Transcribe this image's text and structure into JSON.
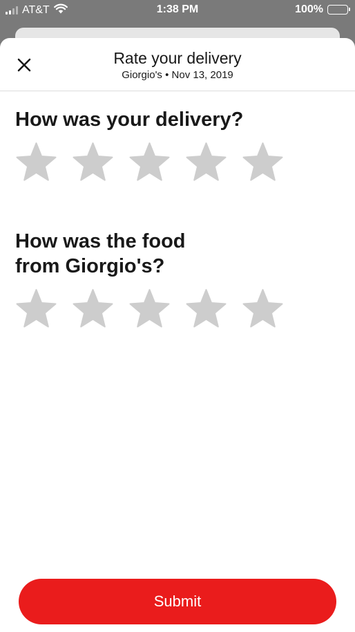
{
  "status_bar": {
    "carrier": "AT&T",
    "time": "1:38 PM",
    "battery": "100%",
    "icons": [
      "signal-icon",
      "wifi-icon",
      "battery-icon"
    ]
  },
  "header": {
    "title": "Rate your delivery",
    "subtitle": "Giorgio's • Nov 13, 2019",
    "close_icon": "close-icon"
  },
  "questions": [
    {
      "text": "How was your delivery?",
      "max_stars": 5,
      "selected": 0
    },
    {
      "text": "How was the food from Giorgio's?",
      "max_stars": 5,
      "selected": 0
    }
  ],
  "submit": {
    "label": "Submit"
  },
  "colors": {
    "accent": "#ea1c1c",
    "star_empty": "#cdcdcd",
    "text": "#191919"
  }
}
